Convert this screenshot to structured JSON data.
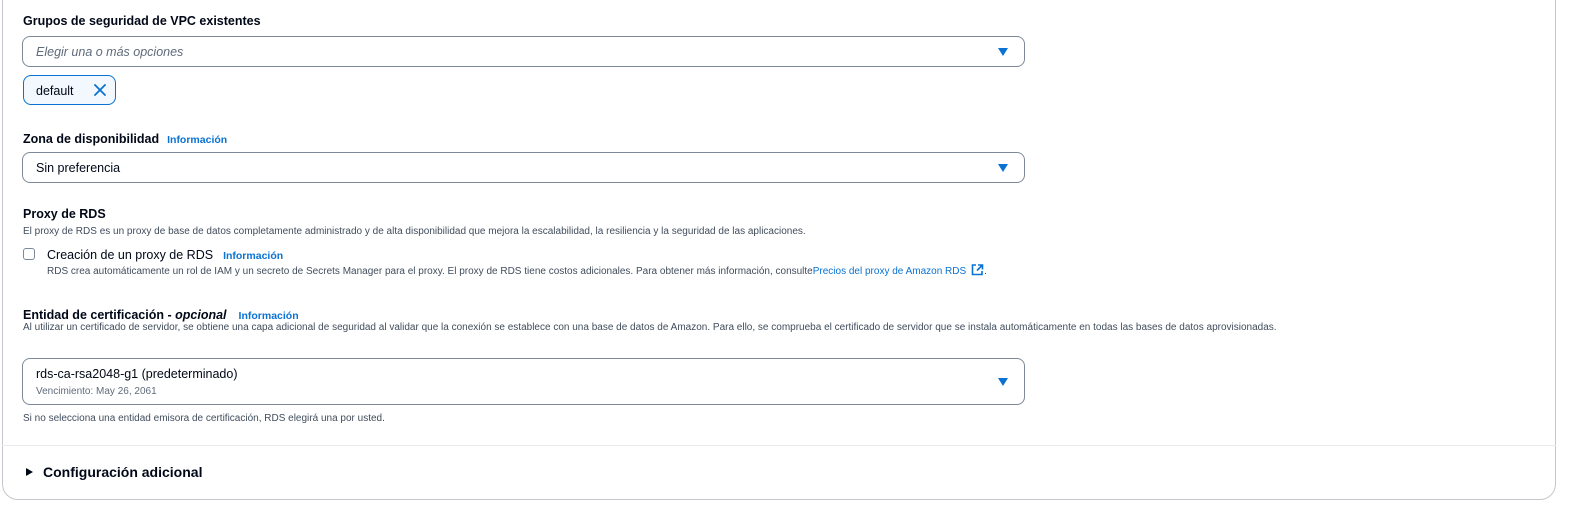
{
  "vpc_security_groups": {
    "label": "Grupos de seguridad de VPC existentes",
    "placeholder": "Elegir una o más opciones",
    "tokens": [
      {
        "label": "default"
      }
    ]
  },
  "availability_zone": {
    "label": "Zona de disponibilidad",
    "info": "Información",
    "value": "Sin preferencia"
  },
  "rds_proxy": {
    "label": "Proxy de RDS",
    "description": "El proxy de RDS es un proxy de base de datos completamente administrado y de alta disponibilidad que mejora la escalabilidad, la resiliencia y la seguridad de las aplicaciones.",
    "checkbox_label": "Creación de un proxy de RDS",
    "checkbox_checked": false,
    "info": "Información",
    "checkbox_description": "RDS crea automáticamente un rol de IAM y un secreto de Secrets Manager para el proxy. El proxy de RDS tiene costos adicionales. Para obtener más información, consulte",
    "link_text": "Precios del proxy de Amazon RDS",
    "link_suffix": "."
  },
  "certificate_authority": {
    "label": "Entidad de certificación - ",
    "optional": "opcional",
    "info": "Información",
    "description": "Al utilizar un certificado de servidor, se obtiene una capa adicional de seguridad al validar que la conexión se establece con una base de datos de Amazon. Para ello, se comprueba el certificado de servidor que se instala automáticamente en todas las bases de datos aprovisionadas.",
    "value": "rds-ca-rsa2048-g1 (predeterminado)",
    "value_sub": "Vencimiento: May 26, 2061",
    "hint": "Si no selecciona una entidad emisora de certificación, RDS elegirá una por usted."
  },
  "additional_config": {
    "label": "Configuración adicional",
    "expanded": false
  },
  "colors": {
    "accent": "#0972d3",
    "text": "#000716",
    "secondary_text": "#414d5c",
    "border": "#7d8998"
  },
  "icons": {
    "caret": "caret-down-icon",
    "remove": "close-icon",
    "external": "external-link-icon",
    "expand": "caret-right-icon"
  }
}
